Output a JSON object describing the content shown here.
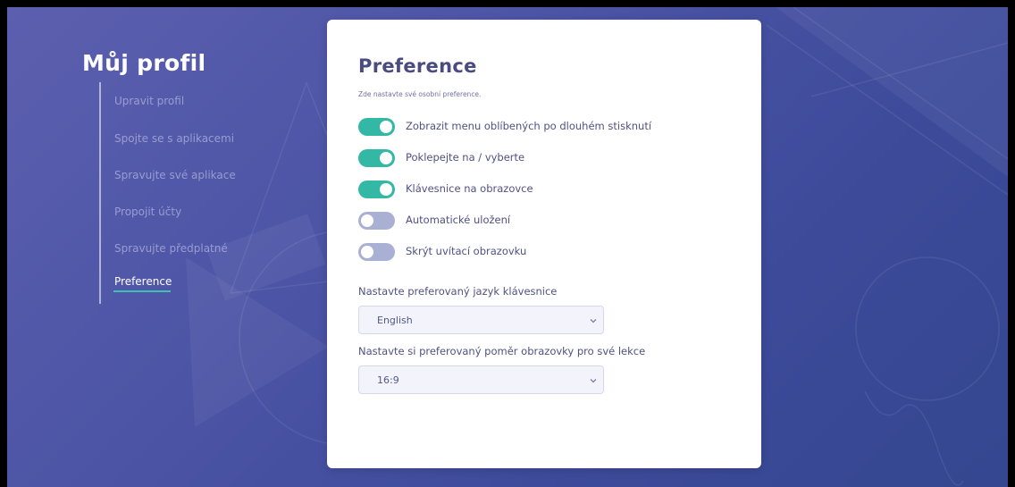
{
  "sidebar": {
    "title": "Můj profil",
    "items": [
      {
        "label": "Upravit profil"
      },
      {
        "label": "Spojte se s aplikacemi"
      },
      {
        "label": "Spravujte své aplikace"
      },
      {
        "label": "Propojit účty"
      },
      {
        "label": "Spravujte předplatné"
      },
      {
        "label": "Preference",
        "active": true
      }
    ]
  },
  "panel": {
    "title": "Preference",
    "subtitle": "Zde nastavte své osobní preference.",
    "toggles": [
      {
        "label": "Zobrazit menu oblíbených po dlouhém stisknutí",
        "on": true
      },
      {
        "label": "Poklepejte na / vyberte",
        "on": true
      },
      {
        "label": "Klávesnice na obrazovce",
        "on": true
      },
      {
        "label": "Automatické uložení",
        "on": false
      },
      {
        "label": "Skrýt uvítací obrazovku",
        "on": false
      }
    ],
    "keyboard_language": {
      "label": "Nastavte preferovaný jazyk klávesnice",
      "value": "English"
    },
    "aspect_ratio": {
      "label": "Nastavte si preferovaný poměr obrazovky pro své lekce",
      "value": "16:9"
    }
  },
  "colors": {
    "accent": "#33b8a6",
    "toggle_off": "#aab0d4",
    "background": "#4d55a6",
    "title_text": "#4a4b7e"
  },
  "icons": {
    "select_arrow": "chevron-down-icon"
  }
}
